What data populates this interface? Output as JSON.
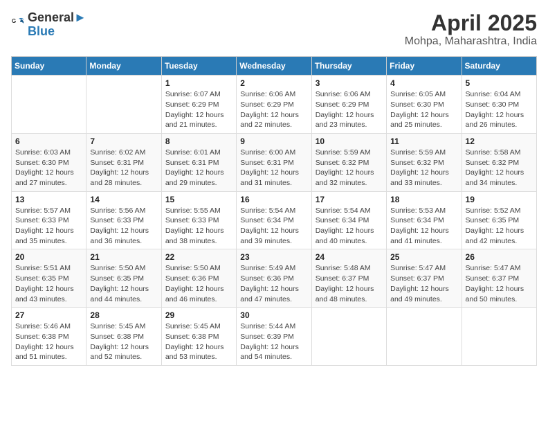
{
  "header": {
    "logo_general": "General",
    "logo_blue": "Blue",
    "title": "April 2025",
    "subtitle": "Mohpa, Maharashtra, India"
  },
  "weekdays": [
    "Sunday",
    "Monday",
    "Tuesday",
    "Wednesday",
    "Thursday",
    "Friday",
    "Saturday"
  ],
  "weeks": [
    [
      null,
      null,
      {
        "day": "1",
        "sunrise": "6:07 AM",
        "sunset": "6:29 PM",
        "daylight": "12 hours and 21 minutes."
      },
      {
        "day": "2",
        "sunrise": "6:06 AM",
        "sunset": "6:29 PM",
        "daylight": "12 hours and 22 minutes."
      },
      {
        "day": "3",
        "sunrise": "6:06 AM",
        "sunset": "6:29 PM",
        "daylight": "12 hours and 23 minutes."
      },
      {
        "day": "4",
        "sunrise": "6:05 AM",
        "sunset": "6:30 PM",
        "daylight": "12 hours and 25 minutes."
      },
      {
        "day": "5",
        "sunrise": "6:04 AM",
        "sunset": "6:30 PM",
        "daylight": "12 hours and 26 minutes."
      }
    ],
    [
      {
        "day": "6",
        "sunrise": "6:03 AM",
        "sunset": "6:30 PM",
        "daylight": "12 hours and 27 minutes."
      },
      {
        "day": "7",
        "sunrise": "6:02 AM",
        "sunset": "6:31 PM",
        "daylight": "12 hours and 28 minutes."
      },
      {
        "day": "8",
        "sunrise": "6:01 AM",
        "sunset": "6:31 PM",
        "daylight": "12 hours and 29 minutes."
      },
      {
        "day": "9",
        "sunrise": "6:00 AM",
        "sunset": "6:31 PM",
        "daylight": "12 hours and 31 minutes."
      },
      {
        "day": "10",
        "sunrise": "5:59 AM",
        "sunset": "6:32 PM",
        "daylight": "12 hours and 32 minutes."
      },
      {
        "day": "11",
        "sunrise": "5:59 AM",
        "sunset": "6:32 PM",
        "daylight": "12 hours and 33 minutes."
      },
      {
        "day": "12",
        "sunrise": "5:58 AM",
        "sunset": "6:32 PM",
        "daylight": "12 hours and 34 minutes."
      }
    ],
    [
      {
        "day": "13",
        "sunrise": "5:57 AM",
        "sunset": "6:33 PM",
        "daylight": "12 hours and 35 minutes."
      },
      {
        "day": "14",
        "sunrise": "5:56 AM",
        "sunset": "6:33 PM",
        "daylight": "12 hours and 36 minutes."
      },
      {
        "day": "15",
        "sunrise": "5:55 AM",
        "sunset": "6:33 PM",
        "daylight": "12 hours and 38 minutes."
      },
      {
        "day": "16",
        "sunrise": "5:54 AM",
        "sunset": "6:34 PM",
        "daylight": "12 hours and 39 minutes."
      },
      {
        "day": "17",
        "sunrise": "5:54 AM",
        "sunset": "6:34 PM",
        "daylight": "12 hours and 40 minutes."
      },
      {
        "day": "18",
        "sunrise": "5:53 AM",
        "sunset": "6:34 PM",
        "daylight": "12 hours and 41 minutes."
      },
      {
        "day": "19",
        "sunrise": "5:52 AM",
        "sunset": "6:35 PM",
        "daylight": "12 hours and 42 minutes."
      }
    ],
    [
      {
        "day": "20",
        "sunrise": "5:51 AM",
        "sunset": "6:35 PM",
        "daylight": "12 hours and 43 minutes."
      },
      {
        "day": "21",
        "sunrise": "5:50 AM",
        "sunset": "6:35 PM",
        "daylight": "12 hours and 44 minutes."
      },
      {
        "day": "22",
        "sunrise": "5:50 AM",
        "sunset": "6:36 PM",
        "daylight": "12 hours and 46 minutes."
      },
      {
        "day": "23",
        "sunrise": "5:49 AM",
        "sunset": "6:36 PM",
        "daylight": "12 hours and 47 minutes."
      },
      {
        "day": "24",
        "sunrise": "5:48 AM",
        "sunset": "6:37 PM",
        "daylight": "12 hours and 48 minutes."
      },
      {
        "day": "25",
        "sunrise": "5:47 AM",
        "sunset": "6:37 PM",
        "daylight": "12 hours and 49 minutes."
      },
      {
        "day": "26",
        "sunrise": "5:47 AM",
        "sunset": "6:37 PM",
        "daylight": "12 hours and 50 minutes."
      }
    ],
    [
      {
        "day": "27",
        "sunrise": "5:46 AM",
        "sunset": "6:38 PM",
        "daylight": "12 hours and 51 minutes."
      },
      {
        "day": "28",
        "sunrise": "5:45 AM",
        "sunset": "6:38 PM",
        "daylight": "12 hours and 52 minutes."
      },
      {
        "day": "29",
        "sunrise": "5:45 AM",
        "sunset": "6:38 PM",
        "daylight": "12 hours and 53 minutes."
      },
      {
        "day": "30",
        "sunrise": "5:44 AM",
        "sunset": "6:39 PM",
        "daylight": "12 hours and 54 minutes."
      },
      null,
      null,
      null
    ]
  ],
  "labels": {
    "sunrise_prefix": "Sunrise: ",
    "sunset_prefix": "Sunset: ",
    "daylight_prefix": "Daylight: "
  }
}
